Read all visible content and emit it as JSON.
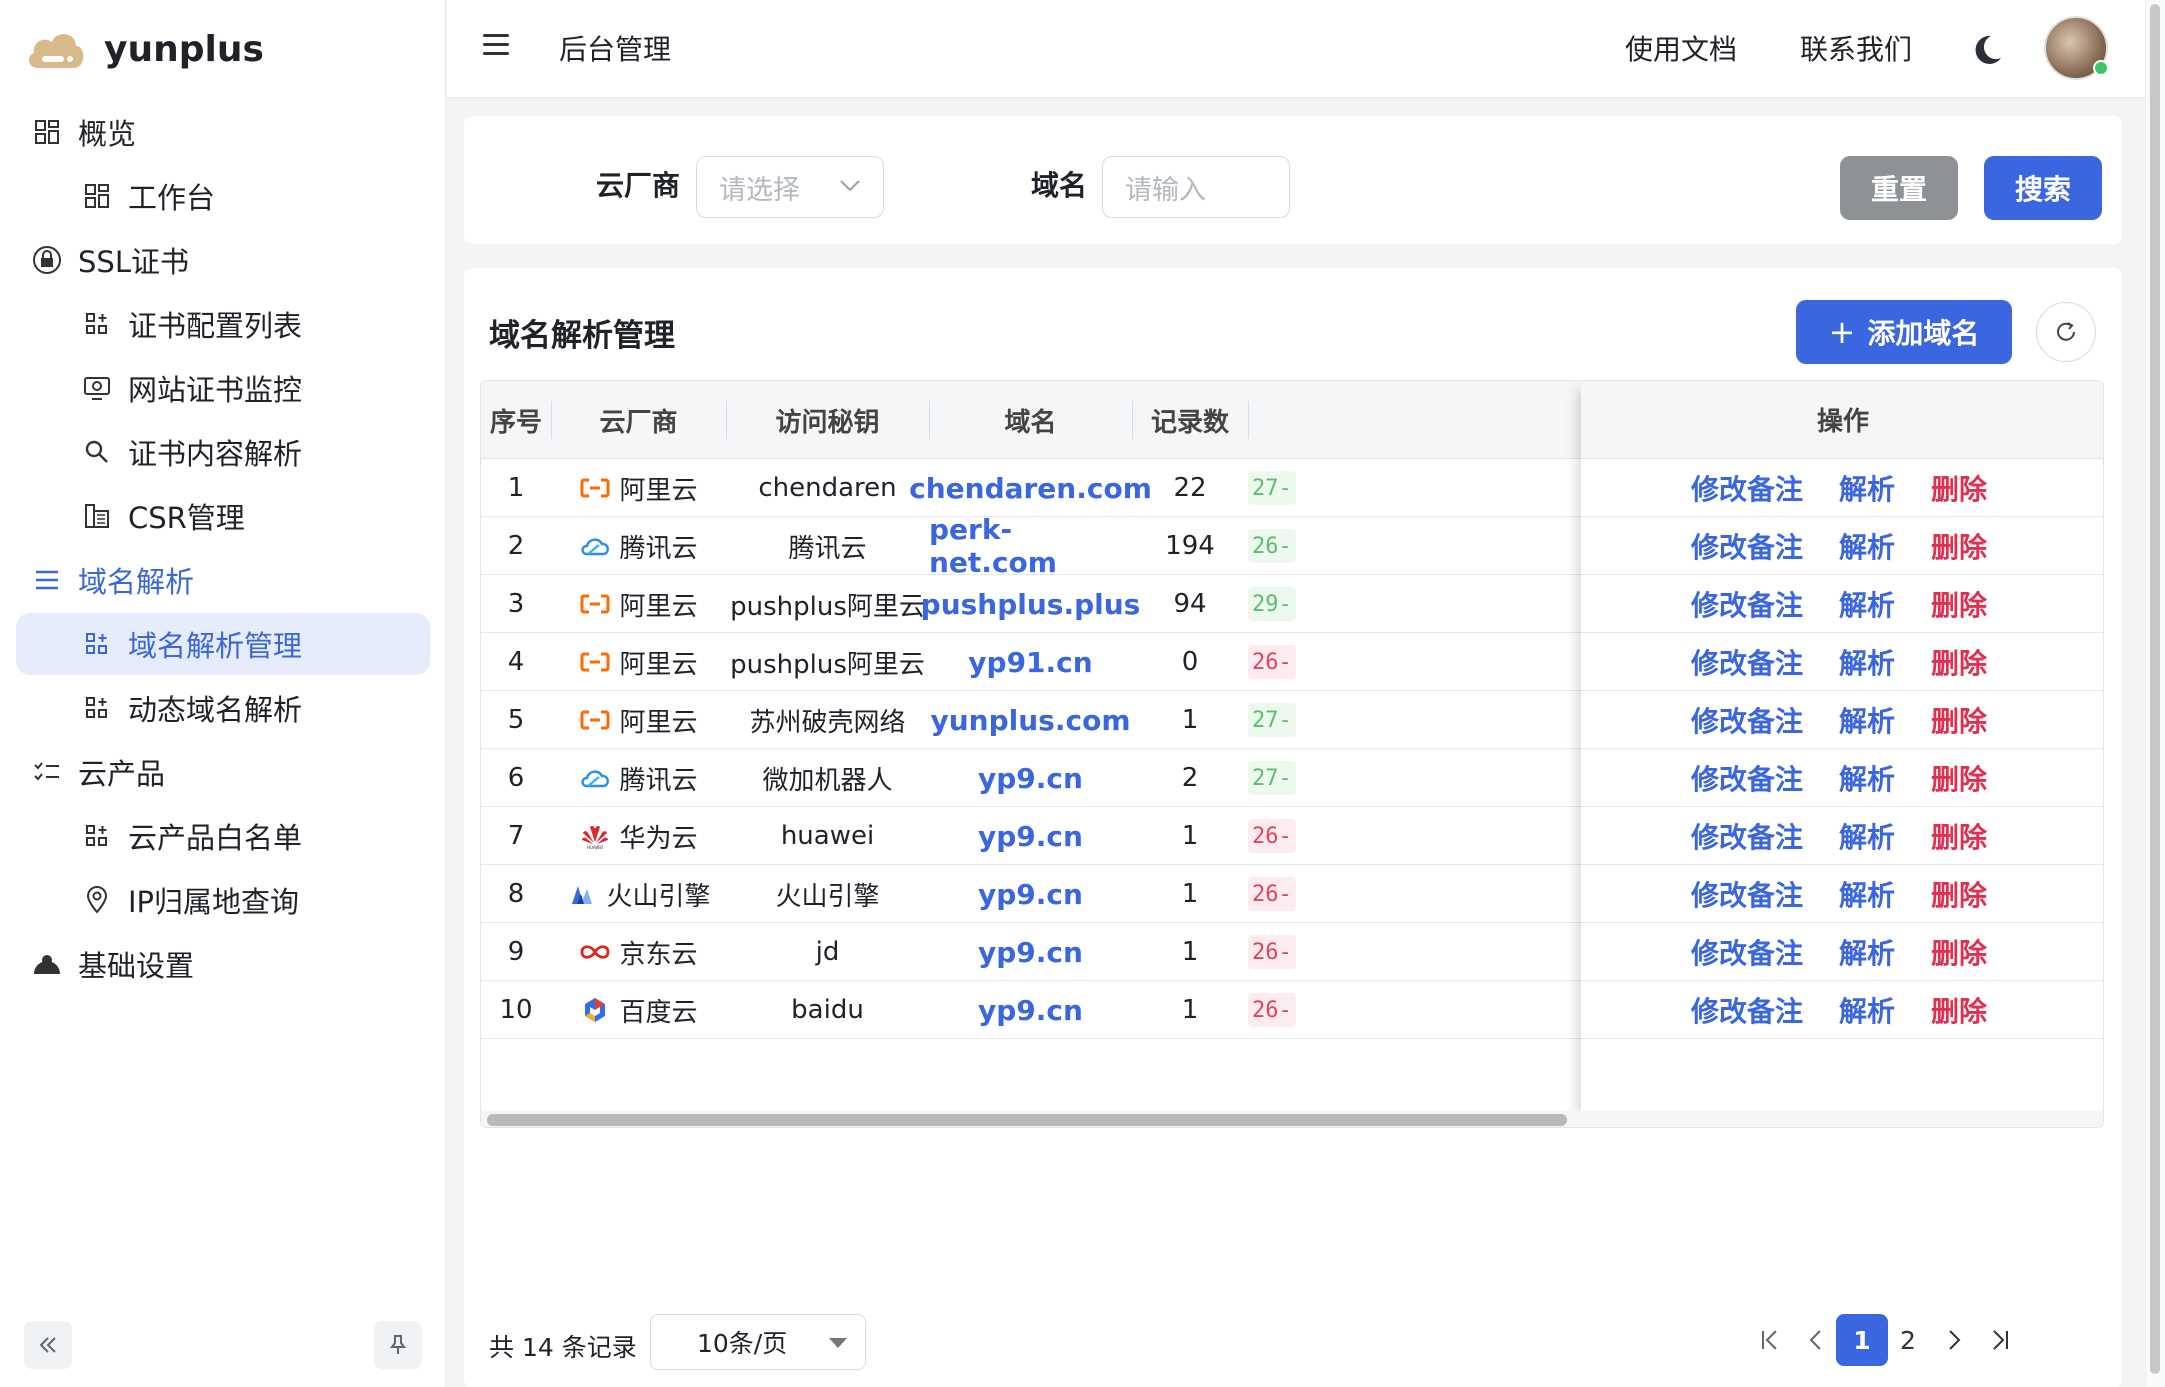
{
  "app": {
    "name": "yunplus"
  },
  "sidebar": {
    "items": [
      {
        "label": "概览",
        "level": 1,
        "icon": "grid-icon"
      },
      {
        "label": "工作台",
        "level": 2,
        "icon": "grid-icon"
      },
      {
        "label": "SSL证书",
        "level": 1,
        "icon": "lock-icon"
      },
      {
        "label": "证书配置列表",
        "level": 2,
        "icon": "apps-icon"
      },
      {
        "label": "网站证书监控",
        "level": 2,
        "icon": "monitor-icon"
      },
      {
        "label": "证书内容解析",
        "level": 2,
        "icon": "search-icon"
      },
      {
        "label": "CSR管理",
        "level": 2,
        "icon": "building-icon"
      },
      {
        "label": "域名解析",
        "level": 1,
        "icon": "list-icon",
        "expanded": true
      },
      {
        "label": "域名解析管理",
        "level": 2,
        "icon": "apps-icon",
        "active": true
      },
      {
        "label": "动态域名解析",
        "level": 2,
        "icon": "apps-icon"
      },
      {
        "label": "云产品",
        "level": 1,
        "icon": "checklist-icon"
      },
      {
        "label": "云产品白名单",
        "level": 2,
        "icon": "apps-icon"
      },
      {
        "label": "IP归属地查询",
        "level": 2,
        "icon": "location-icon"
      },
      {
        "label": "基础设置",
        "level": 1,
        "icon": "settings-icon"
      }
    ]
  },
  "header": {
    "title": "后台管理",
    "docs_link": "使用文档",
    "contact_link": "联系我们"
  },
  "search": {
    "vendor_label": "云厂商",
    "vendor_placeholder": "请选择",
    "domain_label": "域名",
    "domain_placeholder": "请输入",
    "reset_label": "重置",
    "search_label": "搜索"
  },
  "table_panel": {
    "title": "域名解析管理",
    "add_label": "添加域名",
    "columns": [
      "序号",
      "云厂商",
      "访问秘钥",
      "域名",
      "记录数",
      "操作"
    ],
    "rows": [
      {
        "no": "1",
        "vendor": "阿里云",
        "vendor_icon": "aliyun-icon",
        "key": "chendaren",
        "domain": "chendaren.com",
        "records": "22",
        "date": "27-",
        "date_status": "green"
      },
      {
        "no": "2",
        "vendor": "腾讯云",
        "vendor_icon": "tencent-cloud-icon",
        "key": "腾讯云",
        "domain": "perk-net.com",
        "records": "194",
        "date": "26-",
        "date_status": "green"
      },
      {
        "no": "3",
        "vendor": "阿里云",
        "vendor_icon": "aliyun-icon",
        "key": "pushplus阿里云",
        "domain": "pushplus.plus",
        "records": "94",
        "date": "29-",
        "date_status": "green"
      },
      {
        "no": "4",
        "vendor": "阿里云",
        "vendor_icon": "aliyun-icon",
        "key": "pushplus阿里云",
        "domain": "yp91.cn",
        "records": "0",
        "date": "26-",
        "date_status": "red"
      },
      {
        "no": "5",
        "vendor": "阿里云",
        "vendor_icon": "aliyun-icon",
        "key": "苏州破壳网络",
        "domain": "yunplus.com",
        "records": "1",
        "date": "27-",
        "date_status": "green"
      },
      {
        "no": "6",
        "vendor": "腾讯云",
        "vendor_icon": "tencent-cloud-icon",
        "key": "微加机器人",
        "domain": "yp9.cn",
        "records": "2",
        "date": "27-",
        "date_status": "green"
      },
      {
        "no": "7",
        "vendor": "华为云",
        "vendor_icon": "huawei-icon",
        "key": "huawei",
        "domain": "yp9.cn",
        "records": "1",
        "date": "26-",
        "date_status": "red"
      },
      {
        "no": "8",
        "vendor": "火山引擎",
        "vendor_icon": "volcengine-icon",
        "key": "火山引擎",
        "domain": "yp9.cn",
        "records": "1",
        "date": "26-",
        "date_status": "red"
      },
      {
        "no": "9",
        "vendor": "京东云",
        "vendor_icon": "jdcloud-icon",
        "key": "jd",
        "domain": "yp9.cn",
        "records": "1",
        "date": "26-",
        "date_status": "red"
      },
      {
        "no": "10",
        "vendor": "百度云",
        "vendor_icon": "baidu-cloud-icon",
        "key": "baidu",
        "domain": "yp9.cn",
        "records": "1",
        "date": "26-",
        "date_status": "red"
      }
    ],
    "actions": {
      "edit": "修改备注",
      "resolve": "解析",
      "delete": "删除"
    }
  },
  "pagination": {
    "total": "共 14 条记录",
    "page_size": "10条/页",
    "pages": [
      "1",
      "2"
    ],
    "current": "1"
  },
  "colors": {
    "primary": "#3a66e0",
    "danger": "#e0304f",
    "reset": "#8e9196",
    "active_bg": "#e6ecfb"
  }
}
